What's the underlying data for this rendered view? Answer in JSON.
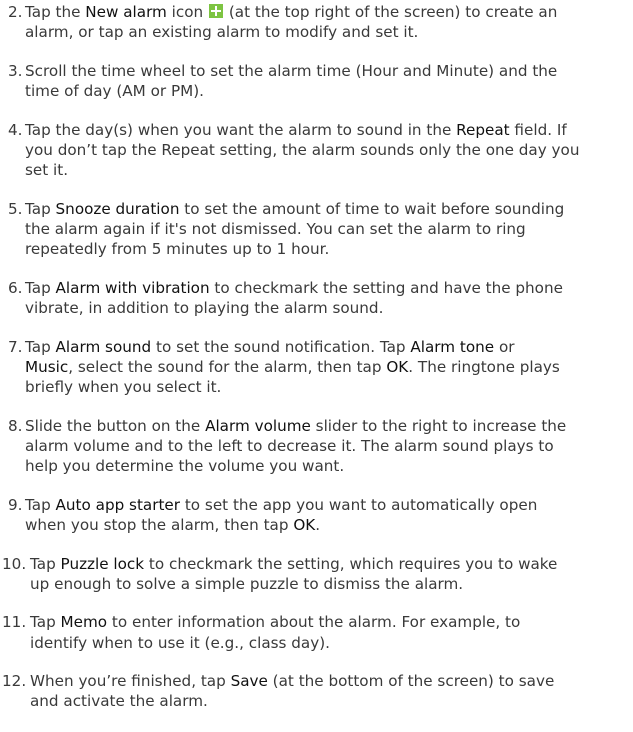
{
  "steps": [
    {
      "number": "2.",
      "lines": [
        [
          "Tap the ",
          {
            "b": "New alarm"
          },
          " icon ",
          {
            "icon": "plus-icon"
          },
          " (at the top right of the screen) to create an"
        ],
        [
          "alarm, or tap an existing alarm to modify and set it."
        ]
      ]
    },
    {
      "number": "3.",
      "lines": [
        [
          "Scroll the time wheel to set the alarm time (Hour and Minute) and the"
        ],
        [
          "time of day (AM or PM)."
        ]
      ]
    },
    {
      "number": "4.",
      "lines": [
        [
          "Tap the day(s) when you want the alarm to sound in the ",
          {
            "b": "Repeat"
          },
          " field. If"
        ],
        [
          "you don’t tap the Repeat setting, the alarm sounds only the one day you"
        ],
        [
          "set it."
        ]
      ]
    },
    {
      "number": "5.",
      "lines": [
        [
          "Tap ",
          {
            "b": "Snooze duration"
          },
          " to set the amount of time to wait before sounding"
        ],
        [
          "the alarm again if it's not dismissed. You can set the alarm to ring"
        ],
        [
          "repeatedly from 5 minutes up to 1 hour."
        ]
      ]
    },
    {
      "number": "6.",
      "lines": [
        [
          "Tap ",
          {
            "b": "Alarm with vibration"
          },
          " to checkmark the setting and have the phone"
        ],
        [
          "vibrate, in addition to playing the alarm sound."
        ]
      ]
    },
    {
      "number": "7.",
      "lines": [
        [
          "Tap ",
          {
            "b": "Alarm sound"
          },
          " to set the sound notification. Tap ",
          {
            "b": "Alarm tone"
          },
          " or"
        ],
        [
          {
            "b": "Music"
          },
          ", select the sound for the alarm, then tap ",
          {
            "b": "OK"
          },
          ". The ringtone plays"
        ],
        [
          "briefly when you select it."
        ]
      ]
    },
    {
      "number": "8.",
      "lines": [
        [
          "Slide the button on the ",
          {
            "b": "Alarm volume"
          },
          " slider to the right to increase the"
        ],
        [
          "alarm volume and to the left to decrease it. The alarm sound plays to"
        ],
        [
          "help you determine the volume you want."
        ]
      ]
    },
    {
      "number": "9.",
      "lines": [
        [
          "Tap ",
          {
            "b": "Auto app starter"
          },
          " to set the app you want to automatically open"
        ],
        [
          "when you stop the alarm, then tap ",
          {
            "b": "OK"
          },
          "."
        ]
      ]
    },
    {
      "number": "10.",
      "lines": [
        [
          "Tap ",
          {
            "b": "Puzzle lock"
          },
          " to checkmark the setting, which requires you to wake"
        ],
        [
          "up enough to solve a simple puzzle to dismiss the alarm."
        ]
      ]
    },
    {
      "number": "11.",
      "lines": [
        [
          "Tap ",
          {
            "b": "Memo"
          },
          " to enter information about the alarm. For example, to"
        ],
        [
          "identify when to use it (e.g., class day)."
        ]
      ]
    },
    {
      "number": "12.",
      "lines": [
        [
          "When you’re finished, tap ",
          {
            "b": "Save"
          },
          " (at the bottom of the screen) to save"
        ],
        [
          "and activate the alarm."
        ]
      ]
    }
  ],
  "colors": {
    "text": "#3a3a3a",
    "bold_text": "#111111",
    "icon_green": "#7dc442"
  }
}
